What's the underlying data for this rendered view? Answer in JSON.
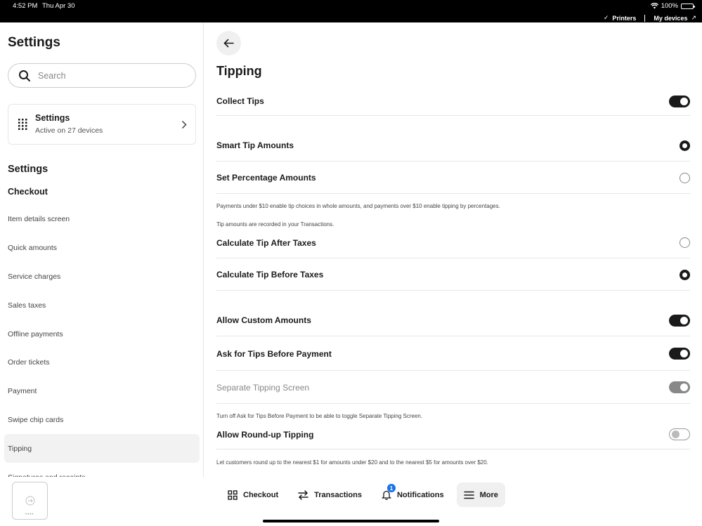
{
  "status_bar": {
    "time": "4:52 PM",
    "date": "Thu Apr 30",
    "battery": "100%",
    "printers": "Printers",
    "my_devices": "My devices"
  },
  "sidebar": {
    "title": "Settings",
    "search_placeholder": "Search",
    "device_card": {
      "title": "Settings",
      "subtitle": "Active on 27 devices"
    },
    "section_title": "Settings",
    "section_subtitle": "Checkout",
    "items": [
      {
        "label": "Item details screen"
      },
      {
        "label": "Quick amounts"
      },
      {
        "label": "Service charges"
      },
      {
        "label": "Sales taxes"
      },
      {
        "label": "Offline payments"
      },
      {
        "label": "Order tickets"
      },
      {
        "label": "Payment"
      },
      {
        "label": "Swipe chip cards"
      },
      {
        "label": "Tipping"
      },
      {
        "label": "Signatures and receipts"
      }
    ]
  },
  "main": {
    "title": "Tipping",
    "collect_tips": "Collect Tips",
    "smart_tip": "Smart Tip Amounts",
    "set_percentage": "Set Percentage Amounts",
    "note_smart": "Payments under $10 enable tip choices in whole amounts, and payments over $10 enable tipping by percentages.",
    "note_recorded": "Tip amounts are recorded in your Transactions.",
    "after_taxes": "Calculate Tip After Taxes",
    "before_taxes": "Calculate Tip Before Taxes",
    "custom_amounts": "Allow Custom Amounts",
    "ask_before": "Ask for Tips Before Payment",
    "separate_screen": "Separate Tipping Screen",
    "note_separate": "Turn off Ask for Tips Before Payment to be able to toggle Separate Tipping Screen.",
    "round_up": "Allow Round-up Tipping",
    "note_round": "Let customers round up to the nearest $1 for amounts under $20 and to the nearest $5 for amounts over $20."
  },
  "tabbar": {
    "checkout": "Checkout",
    "transactions": "Transactions",
    "notifications": "Notifications",
    "notifications_badge": "1",
    "more": "More"
  }
}
